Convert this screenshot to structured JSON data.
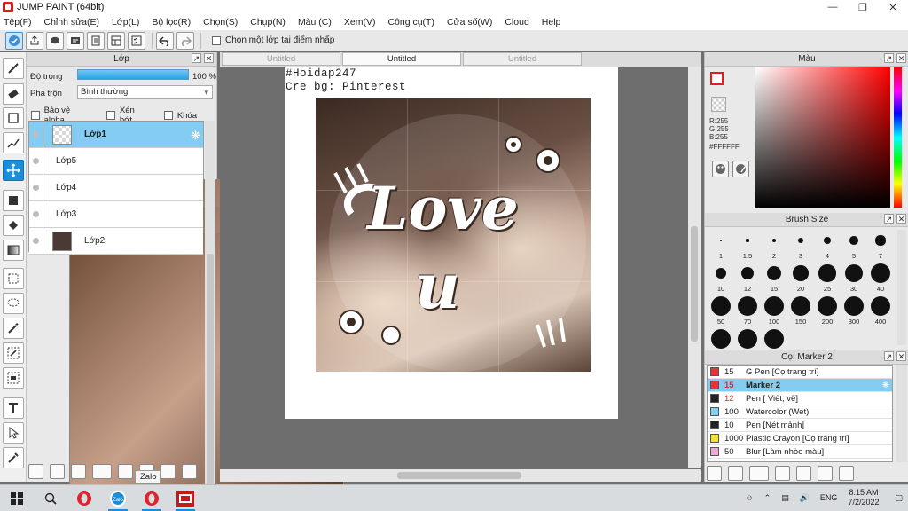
{
  "window": {
    "title": "JUMP PAINT (64bit)"
  },
  "menu": [
    "Tệp(F)",
    "Chỉnh sửa(E)",
    "Lớp(L)",
    "Bộ lọc(R)",
    "Chọn(S)",
    "Chụp(N)",
    "Màu (C)",
    "Xem(V)",
    "Công cụ(T)",
    "Cửa số(W)",
    "Cloud",
    "Help"
  ],
  "toolbar": {
    "select_layer_label": "Chọn một lớp tại điểm nhấp"
  },
  "layer_panel": {
    "title": "Lớp",
    "opacity_label": "Độ trong",
    "opacity_value": "100 %",
    "opacity_percent": 100,
    "blend_label": "Pha trộn",
    "blend_value": "Bình thường",
    "protect_alpha": "Bảo vệ alpha",
    "clip": "Xén bớt",
    "lock": "Khóa",
    "layers": [
      {
        "name": "Lớp1",
        "thumb": "transparent",
        "selected": true
      },
      {
        "name": "Lớp5",
        "thumb": "photo",
        "selected": false
      },
      {
        "name": "Lớp4",
        "thumb": "photo",
        "selected": false
      },
      {
        "name": "Lớp3",
        "thumb": "photo",
        "selected": false
      },
      {
        "name": "Lớp2",
        "thumb": "dark",
        "selected": false
      }
    ]
  },
  "canvas": {
    "tabs": [
      {
        "label": "Untitled",
        "active": false
      },
      {
        "label": "Untitled",
        "active": true
      },
      {
        "label": "Untitled",
        "active": false
      }
    ],
    "caption_line1": "#Hoidap247",
    "caption_line2": "Cre bg: Pinterest",
    "artwork_text_1": "Love",
    "artwork_text_2": "u"
  },
  "color_panel": {
    "title": "Màu",
    "r": "R:255",
    "g": "G:255",
    "b": "B:255",
    "hex": "#FFFFFF",
    "fg_color": "#FFFFFF",
    "accent": "#E02020"
  },
  "brush_size_panel": {
    "title": "Brush Size",
    "sizes": [
      "1",
      "1.5",
      "2",
      "3",
      "4",
      "5",
      "7",
      "10",
      "12",
      "15",
      "20",
      "25",
      "30",
      "40",
      "50",
      "70",
      "100",
      "150",
      "200",
      "300",
      "400",
      "",
      "",
      ""
    ]
  },
  "marker_panel": {
    "title": "Cọ: Marker 2",
    "items": [
      {
        "size": "15",
        "name": "G Pen [Cọ trang trí]",
        "color": "#E8323A",
        "selected": false
      },
      {
        "size": "15",
        "name": "Marker 2",
        "color": "#E8323A",
        "selected": true
      },
      {
        "size": "12",
        "name": "Pen [ Viết, vẽ]",
        "color": "#222222",
        "selected": false
      },
      {
        "size": "100",
        "name": "Watercolor (Wet)",
        "color": "#7FD3F2",
        "selected": false
      },
      {
        "size": "10",
        "name": "Pen [Nét mảnh]",
        "color": "#222222",
        "selected": false
      },
      {
        "size": "1000",
        "name": "Plastic Crayon [Cọ trang trí]",
        "color": "#F2E330",
        "selected": false
      },
      {
        "size": "50",
        "name": "Blur [Làm nhòe màu]",
        "color": "#F2A6D8",
        "selected": false
      }
    ]
  },
  "taskbar": {
    "tooltip": "Zalo",
    "language": "ENG",
    "time": "8:15 AM",
    "date": "7/2/2022"
  }
}
